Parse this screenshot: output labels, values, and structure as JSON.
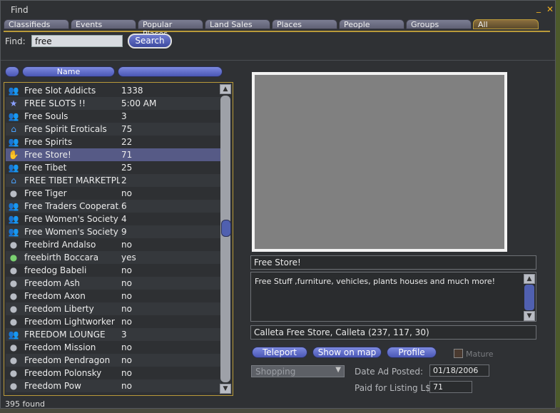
{
  "window": {
    "title": "Find",
    "minimize_icon": "_",
    "close_icon": "✕"
  },
  "tabs": [
    "Classifieds",
    "Events",
    "Popular Places",
    "Land Sales",
    "Places",
    "People",
    "Groups",
    "All"
  ],
  "search": {
    "label": "Find:",
    "value": "free",
    "button": "Search"
  },
  "columns": {
    "icon": "",
    "name": "Name",
    "value": ""
  },
  "results": [
    {
      "icon": "group-icon",
      "glyph": "👥",
      "name": "Free Slot Addicts",
      "value": "1338"
    },
    {
      "icon": "event-icon",
      "glyph": "★",
      "name": "FREE SLOTS !!",
      "value": "5:00 AM"
    },
    {
      "icon": "group-icon",
      "glyph": "👥",
      "name": "Free Souls",
      "value": "3"
    },
    {
      "icon": "house-icon",
      "glyph": "⌂",
      "name": "Free Spirit Eroticals",
      "value": "75"
    },
    {
      "icon": "group-icon",
      "glyph": "👥",
      "name": "Free Spirits",
      "value": "22"
    },
    {
      "icon": "place-icon",
      "glyph": "✋",
      "name": "Free Store!",
      "value": "71"
    },
    {
      "icon": "group-icon",
      "glyph": "👥",
      "name": "Free Tibet",
      "value": "25"
    },
    {
      "icon": "house-icon",
      "glyph": "⌂",
      "name": "FREE TIBET MARKETPLA...",
      "value": "2"
    },
    {
      "icon": "person-icon",
      "glyph": "●",
      "name": "Free Tiger",
      "value": "no"
    },
    {
      "icon": "group-icon",
      "glyph": "👥",
      "name": "Free Traders Cooperat...",
      "value": "6"
    },
    {
      "icon": "group-icon",
      "glyph": "👥",
      "name": "Free Women's Society ...",
      "value": "4"
    },
    {
      "icon": "group-icon",
      "glyph": "👥",
      "name": "Free Women's Society ...",
      "value": "9"
    },
    {
      "icon": "person-icon",
      "glyph": "●",
      "name": "Freebird Andalso",
      "value": "no"
    },
    {
      "icon": "online-person-icon",
      "glyph": "●",
      "name": "freebirth Boccara",
      "value": "yes"
    },
    {
      "icon": "person-icon",
      "glyph": "●",
      "name": "freedog Babeli",
      "value": "no"
    },
    {
      "icon": "person-icon",
      "glyph": "●",
      "name": "Freedom Ash",
      "value": "no"
    },
    {
      "icon": "person-icon",
      "glyph": "●",
      "name": "Freedom Axon",
      "value": "no"
    },
    {
      "icon": "person-icon",
      "glyph": "●",
      "name": "Freedom Liberty",
      "value": "no"
    },
    {
      "icon": "person-icon",
      "glyph": "●",
      "name": "Freedom Lightworker",
      "value": "no"
    },
    {
      "icon": "group-icon",
      "glyph": "👥",
      "name": "FREEDOM LOUNGE",
      "value": "3"
    },
    {
      "icon": "person-icon",
      "glyph": "●",
      "name": "Freedom Mission",
      "value": "no"
    },
    {
      "icon": "person-icon",
      "glyph": "●",
      "name": "Freedom Pendragon",
      "value": "no"
    },
    {
      "icon": "person-icon",
      "glyph": "●",
      "name": "Freedom Polonsky",
      "value": "no"
    },
    {
      "icon": "person-icon",
      "glyph": "●",
      "name": "Freedom Pow",
      "value": "no"
    }
  ],
  "selected_index": 5,
  "status": "395 found",
  "details": {
    "name": "Free Store!",
    "description": "Free Stuff ,furniture, vehicles, plants houses and much more!",
    "location": "Calleta Free Store, Calleta (237, 117, 30)",
    "teleport": "Teleport",
    "show_on_map": "Show on map",
    "profile": "Profile",
    "mature": "Mature",
    "category": "Shopping",
    "date_label": "Date Ad Posted:",
    "date_value": "01/18/2006",
    "paid_label": "Paid for Listing L$",
    "paid_value": "71"
  },
  "colors": {
    "accent_gold": "#b99a3a",
    "button_blue": "#4a57b5",
    "selection": "#565a86"
  }
}
